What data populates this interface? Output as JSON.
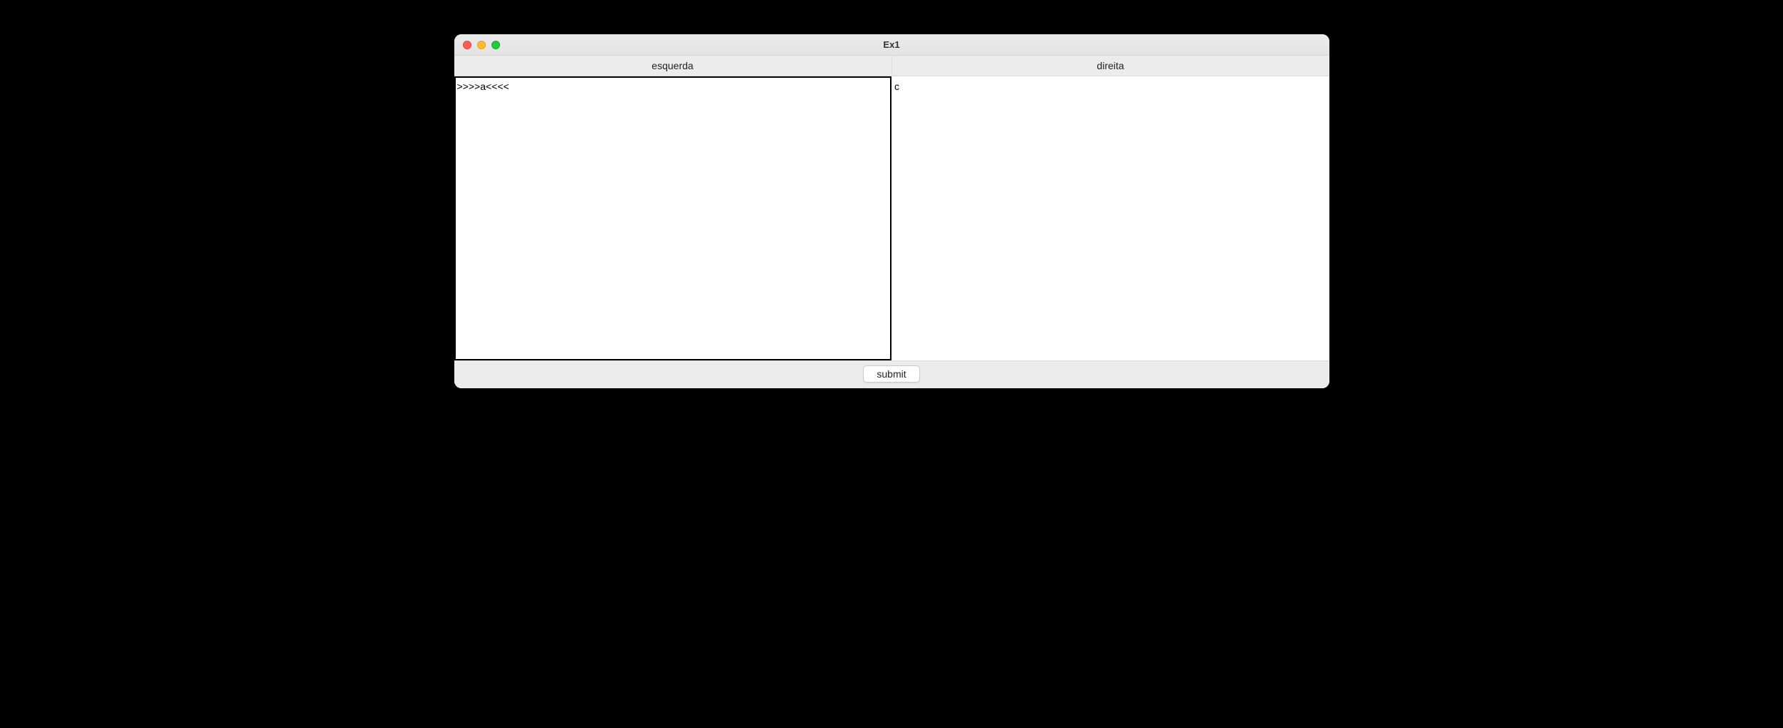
{
  "window": {
    "title": "Ex1"
  },
  "columns": {
    "left_label": "esquerda",
    "right_label": "direita"
  },
  "panes": {
    "left_value": ">>>>a<<<<",
    "right_value": "c"
  },
  "footer": {
    "submit_label": "submit"
  }
}
